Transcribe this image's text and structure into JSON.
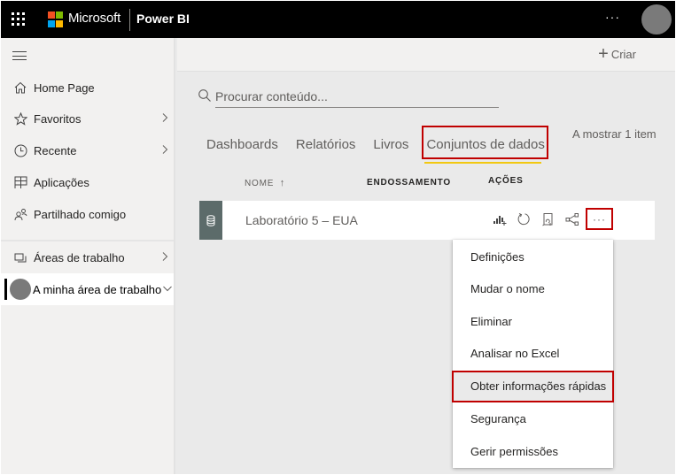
{
  "header": {
    "brand": "Microsoft",
    "product": "Power BI",
    "more_label": "···",
    "ms_logo_colors": [
      "#f25022",
      "#7fba00",
      "#00a4ef",
      "#ffb900"
    ]
  },
  "sidebar": {
    "items": [
      {
        "label": "Home Page",
        "icon": "home-icon",
        "has_chevron": false
      },
      {
        "label": "Favoritos",
        "icon": "star-icon",
        "has_chevron": true
      },
      {
        "label": "Recente",
        "icon": "clock-icon",
        "has_chevron": true
      },
      {
        "label": "Aplicações",
        "icon": "apps-icon",
        "has_chevron": false
      },
      {
        "label": "Partilhado comigo",
        "icon": "shared-icon",
        "has_chevron": false
      },
      {
        "label": "Áreas de trabalho",
        "icon": "workspaces-icon",
        "has_chevron": true
      },
      {
        "label": "A minha área de trabalho",
        "icon": "avatar",
        "has_chevron": true,
        "active": true
      }
    ]
  },
  "commandbar": {
    "create_label": "Criar"
  },
  "search": {
    "placeholder": "Procurar conteúdo..."
  },
  "tabs": [
    {
      "label": "Dashboards"
    },
    {
      "label": "Relatórios"
    },
    {
      "label": "Livros"
    },
    {
      "label": "Conjuntos de dados",
      "active": true
    }
  ],
  "item_count": "A mostrar 1 item",
  "table": {
    "columns": {
      "name": "NOME",
      "endorsement": "ENDOSSAMENTO",
      "actions": "AÇÕES"
    },
    "sort_icon": "↑",
    "rows": [
      {
        "name": "Laboratório 5 – EUA",
        "icon": "dataset-icon"
      }
    ],
    "row_actions": [
      "create-report-icon",
      "refresh-icon",
      "schedule-refresh-icon",
      "share-icon",
      "more-options-icon"
    ],
    "more_label": "···"
  },
  "context_menu": {
    "items": [
      {
        "label": "Definições"
      },
      {
        "label": "Mudar o nome"
      },
      {
        "label": "Eliminar"
      },
      {
        "label": "Analisar no Excel"
      },
      {
        "label": "Obter informações rápidas",
        "highlighted": true
      },
      {
        "label": "Segurança"
      },
      {
        "label": "Gerir permissões"
      }
    ]
  },
  "colors": {
    "highlight_border": "#c00000",
    "tab_underline": "#f2c811",
    "dataset_tile": "#5c6b6a"
  }
}
